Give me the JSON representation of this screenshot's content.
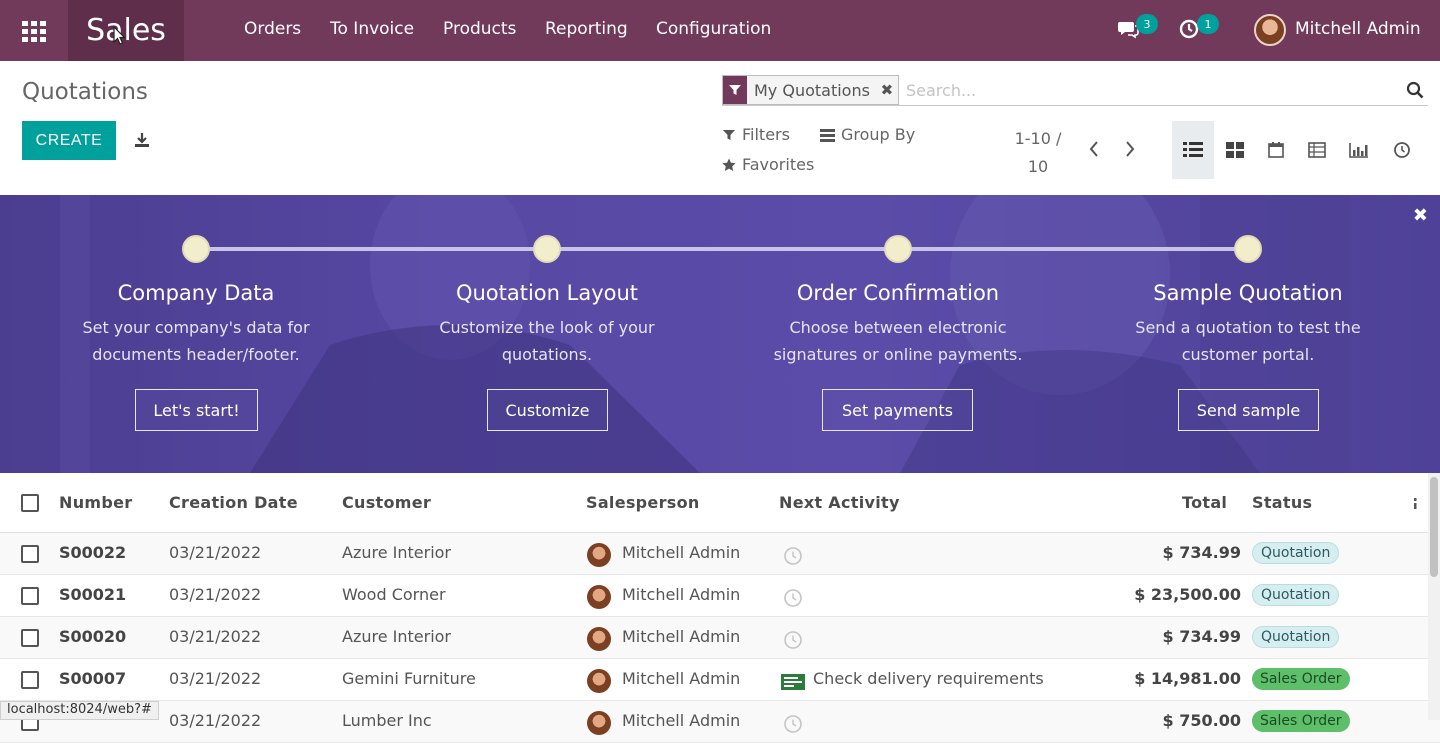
{
  "topbar": {
    "app_name": "Sales",
    "menu": [
      "Orders",
      "To Invoice",
      "Products",
      "Reporting",
      "Configuration"
    ],
    "messages_count": "3",
    "activities_count": "1",
    "user_name": "Mitchell Admin"
  },
  "control": {
    "title": "Quotations",
    "create_label": "CREATE",
    "facet_label": "My Quotations",
    "search_placeholder": "Search...",
    "filters_label": "Filters",
    "group_by_label": "Group By",
    "favorites_label": "Favorites",
    "pager_range": "1-10 /",
    "pager_total": "10"
  },
  "banner": {
    "steps": [
      {
        "title": "Company Data",
        "desc1": "Set your company's data for",
        "desc2": "documents header/footer.",
        "button": "Let's start!"
      },
      {
        "title": "Quotation Layout",
        "desc1": "Customize the look of your",
        "desc2": "quotations.",
        "button": "Customize"
      },
      {
        "title": "Order Confirmation",
        "desc1": "Choose between electronic",
        "desc2": "signatures or online payments.",
        "button": "Set payments"
      },
      {
        "title": "Sample Quotation",
        "desc1": "Send a quotation to test the",
        "desc2": "customer portal.",
        "button": "Send sample"
      }
    ]
  },
  "table": {
    "columns": {
      "number": "Number",
      "creation_date": "Creation Date",
      "customer": "Customer",
      "salesperson": "Salesperson",
      "next_activity": "Next Activity",
      "total": "Total",
      "status": "Status"
    },
    "rows": [
      {
        "number": "S00022",
        "date": "03/21/2022",
        "customer": "Azure Interior",
        "salesperson": "Mitchell Admin",
        "activity": "",
        "total": "$ 734.99",
        "status": "Quotation"
      },
      {
        "number": "S00021",
        "date": "03/21/2022",
        "customer": "Wood Corner",
        "salesperson": "Mitchell Admin",
        "activity": "",
        "total": "$ 23,500.00",
        "status": "Quotation"
      },
      {
        "number": "S00020",
        "date": "03/21/2022",
        "customer": "Azure Interior",
        "salesperson": "Mitchell Admin",
        "activity": "",
        "total": "$ 734.99",
        "status": "Quotation"
      },
      {
        "number": "S00007",
        "date": "03/21/2022",
        "customer": "Gemini Furniture",
        "salesperson": "Mitchell Admin",
        "activity": "Check delivery requirements",
        "total": "$ 14,981.00",
        "status": "Sales Order"
      },
      {
        "number": "",
        "date": "03/21/2022",
        "customer": "Lumber Inc",
        "salesperson": "Mitchell Admin",
        "activity": "",
        "total": "$ 750.00",
        "status": "Sales Order"
      }
    ]
  },
  "status_bar_url": "localhost:8024/web?#",
  "colors": {
    "brand": "#71395a",
    "accent": "#00a09d",
    "banner": "#5648a3"
  }
}
